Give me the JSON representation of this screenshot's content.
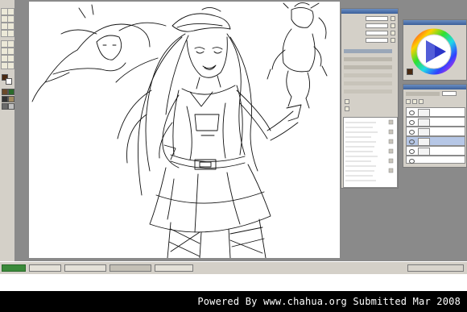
{
  "credit": {
    "text": "Powered By www.chahua.org  Submitted Mar 2008"
  },
  "colors": {
    "desktop": "#8a8a8a",
    "panel": "#d4d0c8",
    "titlebar": "#3b5f9a",
    "foreground_swatch": "#4a2a12",
    "background_swatch": "#ffffff",
    "selected_layer": "#b6c7e6",
    "credit_bar": "#000000"
  },
  "icons": [
    "brush-icon",
    "pen-icon",
    "eraser-icon",
    "fill-icon",
    "hand-icon",
    "zoom-icon",
    "eye-icon",
    "color-wheel-icon"
  ],
  "layers": {
    "count": 6,
    "selected_index": 4
  }
}
